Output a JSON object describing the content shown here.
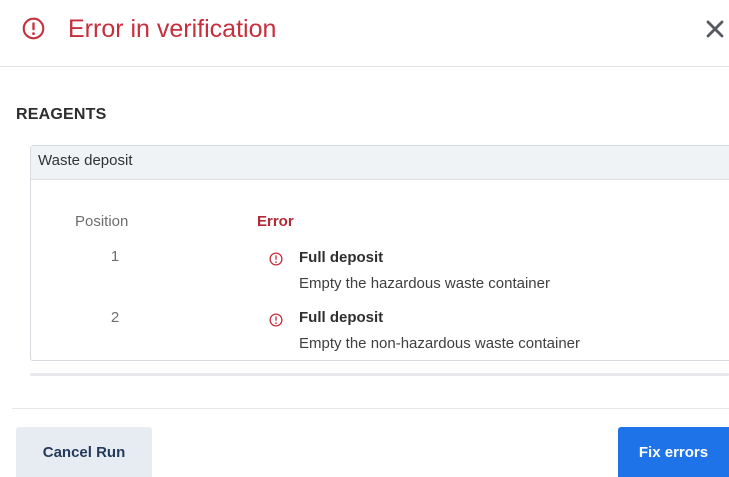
{
  "dialog": {
    "title": "Error in verification",
    "colors": {
      "error_red": "#c62f3b",
      "primary_blue": "#1e73e8",
      "secondary_button_bg": "#e7ecf3"
    },
    "icons": {
      "title_icon": "alert-circle-icon",
      "close_icon": "close-icon",
      "row_icon": "alert-circle-icon"
    }
  },
  "section": {
    "title": "REAGENTS"
  },
  "panel": {
    "title": "Waste deposit",
    "columns": {
      "position": "Position",
      "error": "Error"
    },
    "rows": [
      {
        "position": "1",
        "error_title": "Full deposit",
        "error_description": "Empty the hazardous waste container"
      },
      {
        "position": "2",
        "error_title": "Full deposit",
        "error_description": "Empty the non-hazardous waste container"
      }
    ]
  },
  "footer": {
    "cancel_label": "Cancel Run",
    "fix_label": "Fix errors"
  }
}
